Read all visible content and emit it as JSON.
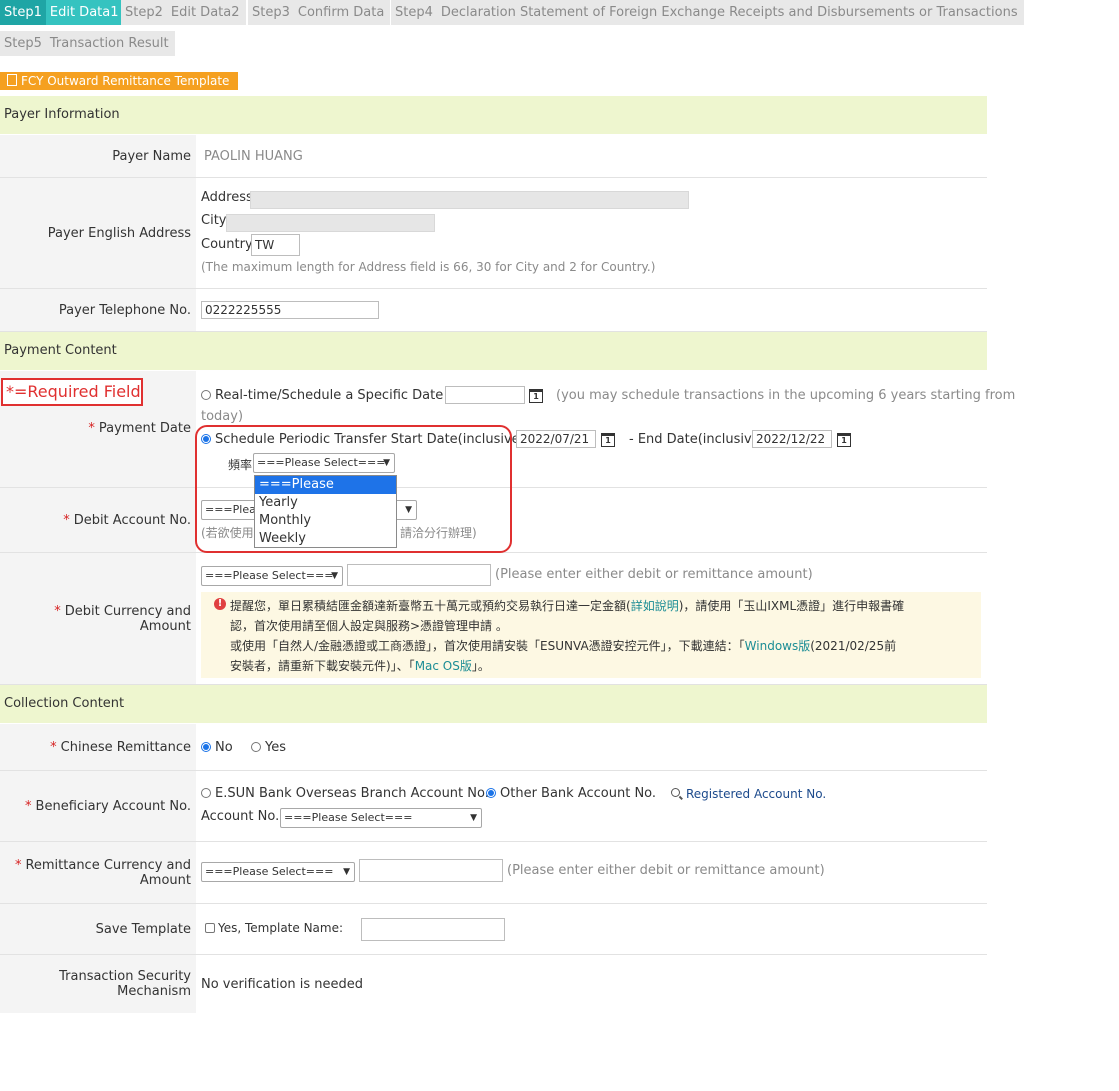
{
  "steps": [
    {
      "num": "Step1",
      "name": "Edit Data1",
      "active": true
    },
    {
      "num": "Step2",
      "name": "Edit Data2",
      "active": false
    },
    {
      "num": "Step3",
      "name": "Confirm Data",
      "active": false
    },
    {
      "num": "Step4",
      "name": "Declaration Statement of Foreign Exchange Receipts and Disbursements or Transactions",
      "active": false
    },
    {
      "num": "Step5",
      "name": "Transaction Result",
      "active": false
    }
  ],
  "template_button": "FCY Outward Remittance Template",
  "sections": {
    "payer": "Payer Information",
    "payment": "Payment Content",
    "collection": "Collection Content"
  },
  "required_field_note": "*=Required Field",
  "star": "*",
  "payer": {
    "name_label": "Payer Name",
    "name_value": "PAOLIN HUANG",
    "address_label": "Payer English Address",
    "address_field": "Address",
    "city_field": "City",
    "country_field": "Country",
    "country_value": "TW",
    "address_hint": "(The maximum length for Address field is 66, 30 for City and 2 for Country.)",
    "phone_label": "Payer Telephone No.",
    "phone_value": "0222225555"
  },
  "payment": {
    "date_label": "Payment Date",
    "option_specific": "Real-time/Schedule a Specific Date",
    "specific_hint_1": "(you may schedule transactions in the upcoming 6 years starting from",
    "specific_hint_2": "today)",
    "option_periodic": "Schedule Periodic Transfer Start Date(inclusive)",
    "start_date": "2022/07/21",
    "end_label": "- End Date(inclusive)",
    "end_date": "2022/12/22",
    "frequency_label": "頻率",
    "frequency_selected": "===Please Select===",
    "frequency_options": [
      "===Please Select===",
      "Yearly",
      "Monthly",
      "Weekly"
    ],
    "debit_account_label": "Debit Account No.",
    "debit_account_select": "===Plea",
    "debit_hint_left": "(若欲使用",
    "debit_hint_right": "請洽分行辦理)",
    "debit_currency_label_1": "Debit Currency and",
    "debit_currency_label_2": "Amount",
    "debit_currency_select": "===Please Select===",
    "debit_amount_hint": "(Please enter either debit or remittance amount)",
    "notice_line1_a": "提醒您，單日累積結匯金額達新臺幣五十萬元或預約交易執行日達一定金額(",
    "notice_line1_link": "詳如說明",
    "notice_line1_b": ")，請使用「玉山IXML憑證」進行申報書確",
    "notice_line2": "認，首次使用請至個人設定與服務>憑證管理申請 。",
    "notice_line3_a": "或使用「自然人/金融憑證或工商憑證」，首次使用請安裝「ESUNVA憑證安控元件」，下載連結：「",
    "notice_line3_link": "Windows版",
    "notice_line3_b": "(2021/02/25前",
    "notice_line4_a": "安裝者，請重新下載安裝元件)」、「",
    "notice_line4_link": "Mac OS版",
    "notice_line4_b": "」。"
  },
  "collection": {
    "chinese_label": "Chinese Remittance",
    "chinese_no": "No",
    "chinese_yes": "Yes",
    "beneficiary_label": "Beneficiary Account No.",
    "esun_option": "E.SUN Bank Overseas Branch Account No.",
    "other_option": "Other Bank Account No.",
    "registered_link": "Registered Account No.",
    "account_no_label": "Account No.:",
    "account_select": "===Please Select===",
    "remit_currency_label_1": "Remittance Currency and",
    "remit_currency_label_2": "Amount",
    "remit_currency_select": "===Please Select===",
    "remit_amount_hint": "(Please enter either debit or remittance amount)",
    "save_template_label": "Save Template",
    "save_template_option": "Yes, Template Name:",
    "security_label_1": "Transaction Security",
    "security_label_2": "Mechanism",
    "security_value": "No verification is needed"
  },
  "colors": {
    "step_active_num": "#1fa5a5",
    "step_active_name": "#35c3c0",
    "template_button": "#f5a020",
    "section_bg": "#eef6cf",
    "required_red": "#e03030",
    "dropdown_selected": "#1e73e8"
  },
  "icons": {
    "calendar": "calendar-icon",
    "search": "search-icon",
    "alert": "alert-icon",
    "document": "document-icon"
  }
}
